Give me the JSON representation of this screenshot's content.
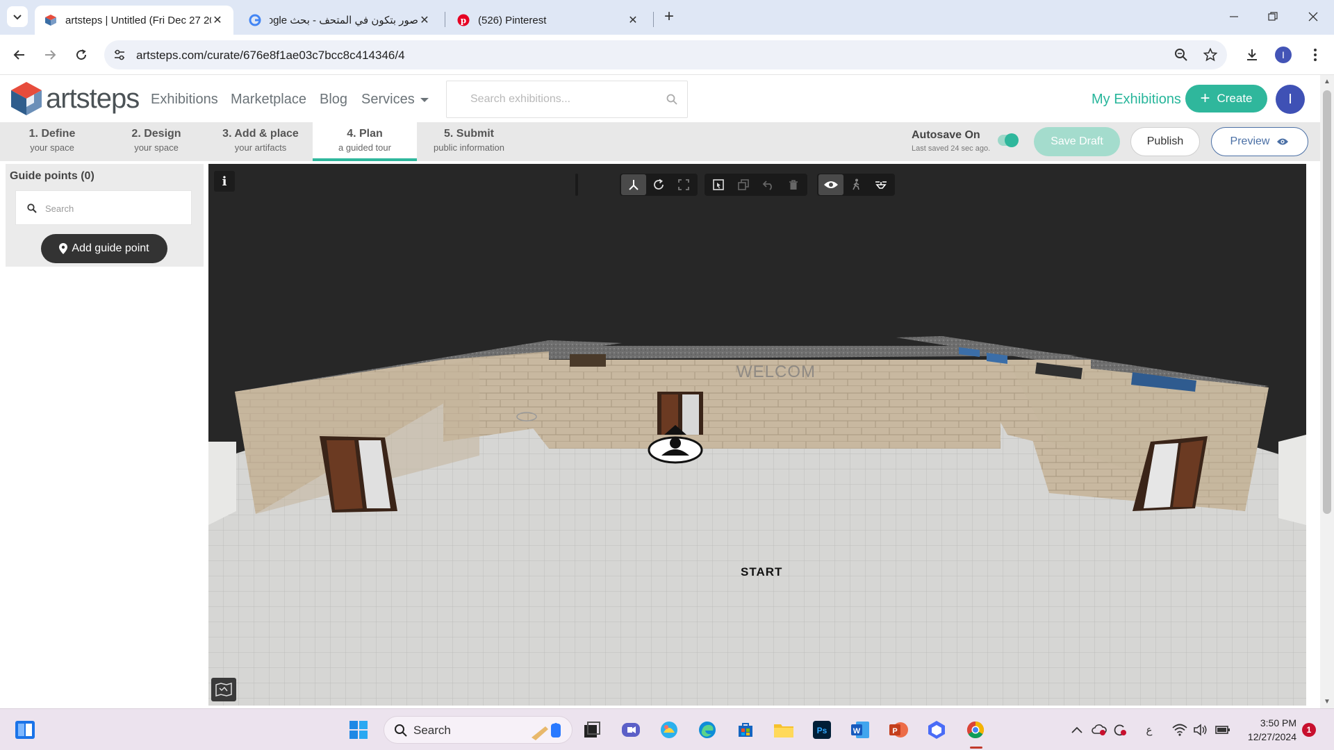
{
  "browser": {
    "tabs": [
      {
        "title": "artsteps | Untitled (Fri Dec 27 20",
        "active": true
      },
      {
        "title": "صور بتكون في المتحف - بحث Google",
        "active": false
      },
      {
        "title": "(526) Pinterest",
        "active": false
      }
    ],
    "url": "artsteps.com/curate/676e8f1ae03c7bcc8c414346/4",
    "profile_initial": "I"
  },
  "site": {
    "logo": "artsteps",
    "nav": {
      "exhibitions": "Exhibitions",
      "marketplace": "Marketplace",
      "blog": "Blog",
      "services": "Services"
    },
    "search_placeholder": "Search exhibitions...",
    "my_exhibitions": "My Exhibitions",
    "create": "Create",
    "user_initial": "I"
  },
  "steps": [
    {
      "title": "1. Define",
      "sub": "your space"
    },
    {
      "title": "2. Design",
      "sub": "your space"
    },
    {
      "title": "3. Add & place",
      "sub": "your artifacts"
    },
    {
      "title": "4. Plan",
      "sub": "a guided tour"
    },
    {
      "title": "5. Submit",
      "sub": "public information"
    }
  ],
  "active_step": 4,
  "autosave": {
    "title": "Autosave On",
    "sub": "Last saved 24 sec ago.",
    "enabled": true
  },
  "actions": {
    "save_draft": "Save Draft",
    "publish": "Publish",
    "preview": "Preview"
  },
  "guide_panel": {
    "title": "Guide points (0)",
    "search_placeholder": "Search",
    "add_button": "Add guide point"
  },
  "viewport": {
    "wall_text": "WELCOM",
    "start_label": "START"
  },
  "taskbar": {
    "search": "Search",
    "time": "3:50 PM",
    "date": "12/27/2024",
    "notifications": "1",
    "lang": "ع"
  },
  "colors": {
    "accent": "#2fb79c",
    "profile": "#3f51b5",
    "tabstrip": "#dfe7f5",
    "taskbar": "#ece3ee"
  }
}
